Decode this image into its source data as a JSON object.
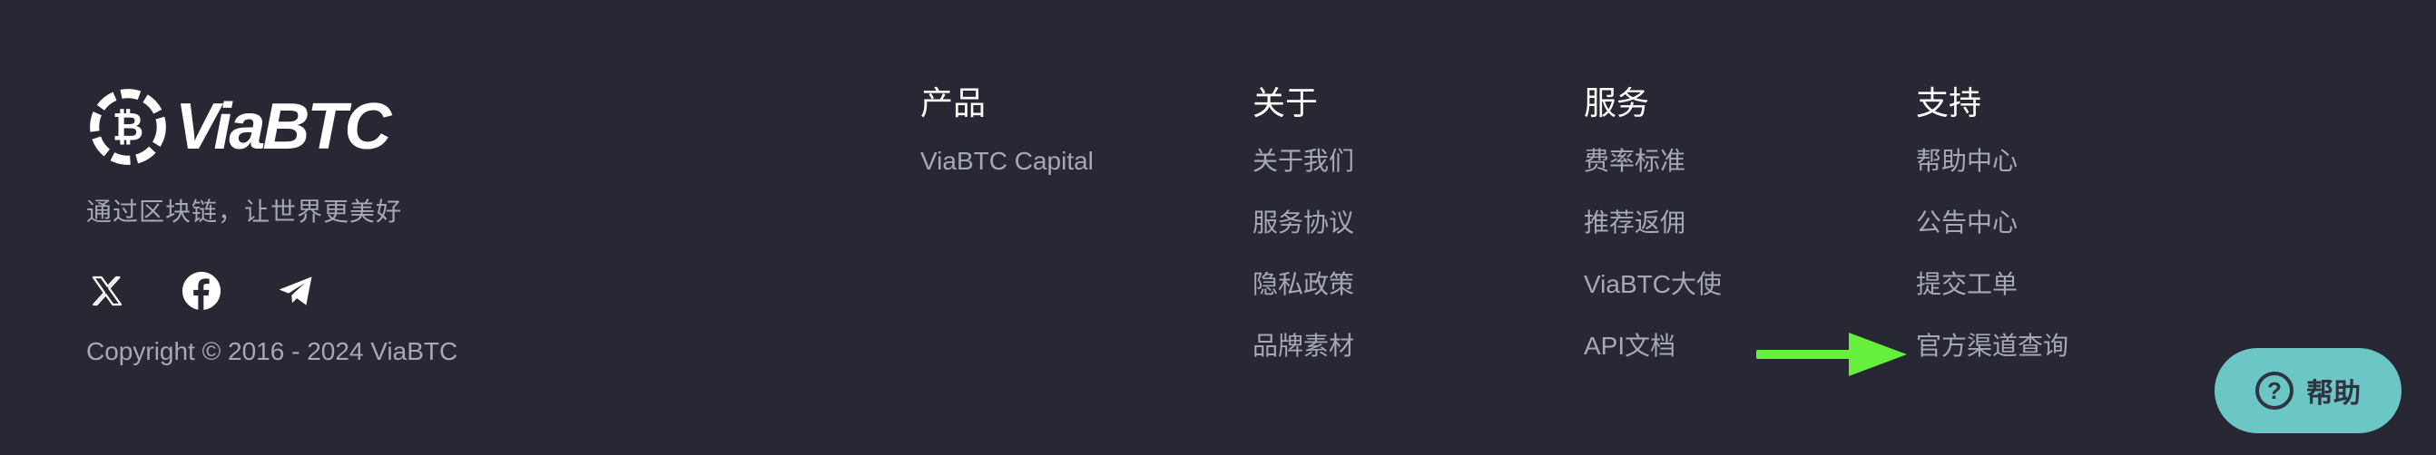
{
  "brand": {
    "name": "ViaBTC",
    "tagline": "通过区块链，让世界更美好",
    "copyright": "Copyright © 2016 - 2024 ViaBTC"
  },
  "socials": [
    {
      "icon": "x-twitter-icon"
    },
    {
      "icon": "facebook-icon"
    },
    {
      "icon": "telegram-icon"
    }
  ],
  "columns": {
    "products": {
      "title": "产品",
      "links": [
        "ViaBTC Capital"
      ]
    },
    "about": {
      "title": "关于",
      "links": [
        "关于我们",
        "服务协议",
        "隐私政策",
        "品牌素材"
      ]
    },
    "services": {
      "title": "服务",
      "links": [
        "费率标准",
        "推荐返佣",
        "ViaBTC大使",
        "API文档"
      ]
    },
    "support": {
      "title": "支持",
      "links": [
        "帮助中心",
        "公告中心",
        "提交工单",
        "官方渠道查询"
      ]
    }
  },
  "help_button": {
    "label": "帮助",
    "icon": "question-circle-icon"
  },
  "colors": {
    "background": "#272833",
    "link": "#a6a8b5",
    "help_button": "#6cc6c6",
    "arrow": "#66f03c"
  }
}
